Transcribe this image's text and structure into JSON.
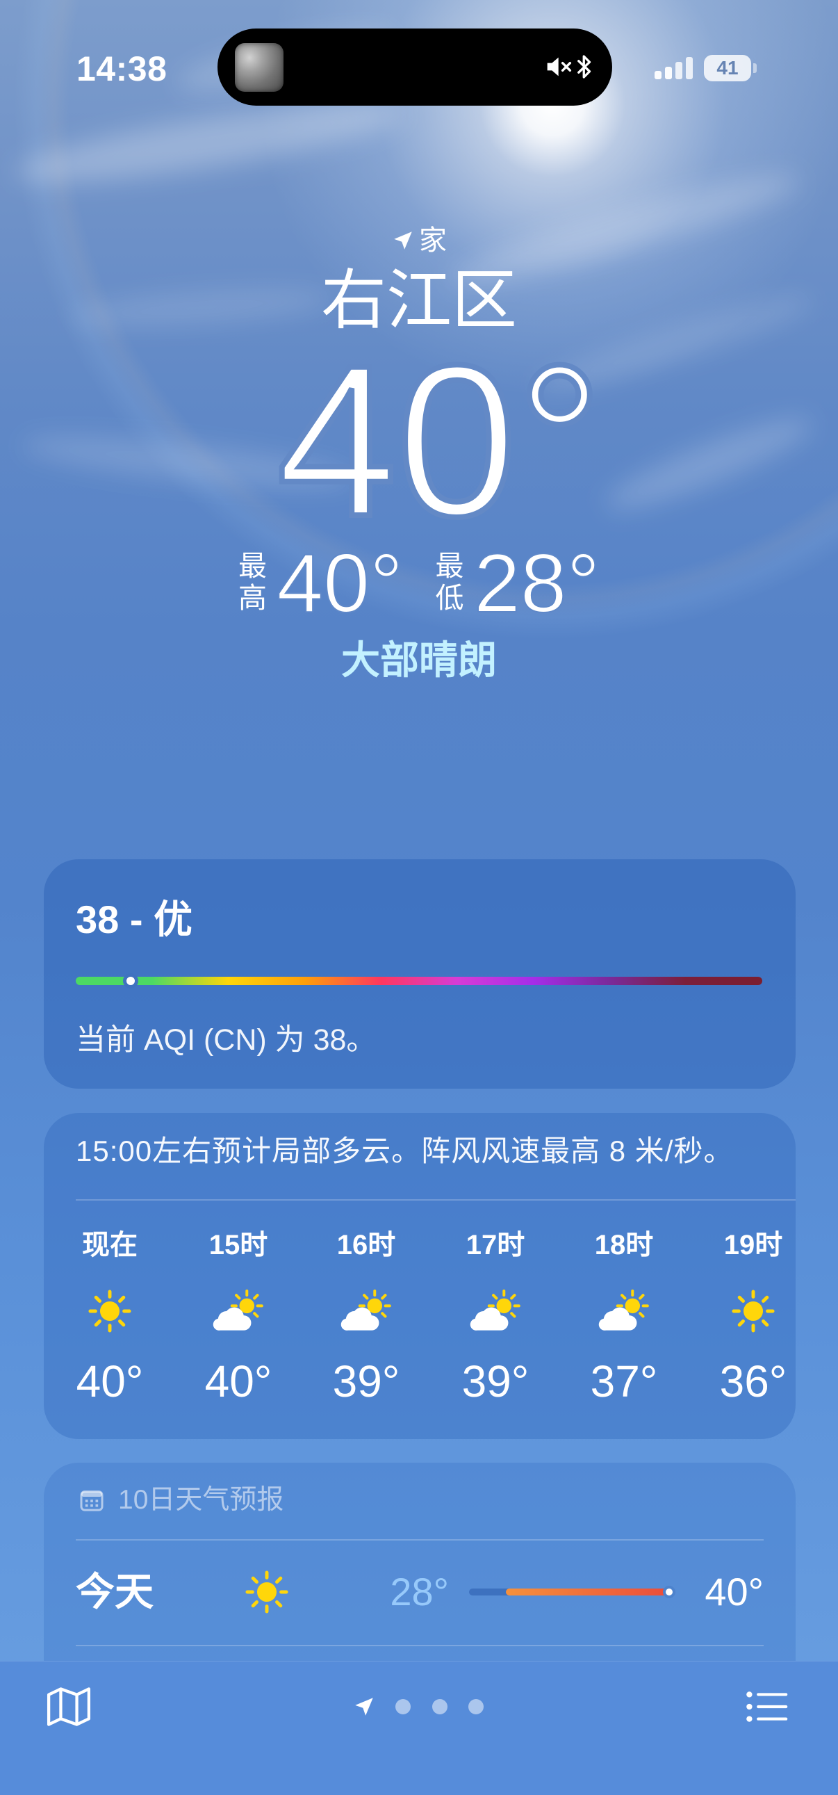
{
  "status_bar": {
    "time": "14:38",
    "battery_level": "41",
    "signal_icon": "cellular-signal-icon",
    "battery_icon": "battery-icon"
  },
  "dynamic_island": {
    "thumbnail": "now-playing-thumbnail",
    "audio_icon": "speaker-muted-icon",
    "bluetooth_icon": "bluetooth-icon"
  },
  "location": {
    "icon": "location-arrow-icon",
    "label": "家",
    "city": "右江区"
  },
  "current": {
    "temperature": "40°",
    "high_label": "最高",
    "high": "40°",
    "low_label": "最低",
    "low": "28°",
    "condition": "大部晴朗"
  },
  "aqi": {
    "title": "38 - 优",
    "description": "当前 AQI (CN) 为 38。",
    "indicator_fraction": 0.08
  },
  "hourly": {
    "summary": "15:00左右预计局部多云。阵风风速最高 8 米/秒。",
    "items": [
      {
        "label": "现在",
        "icon": "sun-icon",
        "temp": "40°"
      },
      {
        "label": "15时",
        "icon": "partly-cloudy-icon",
        "temp": "40°"
      },
      {
        "label": "16时",
        "icon": "partly-cloudy-icon",
        "temp": "39°"
      },
      {
        "label": "17时",
        "icon": "partly-cloudy-icon",
        "temp": "39°"
      },
      {
        "label": "18时",
        "icon": "partly-cloudy-icon",
        "temp": "37°"
      },
      {
        "label": "19时",
        "icon": "sun-icon",
        "temp": "36°"
      }
    ]
  },
  "daily": {
    "icon": "calendar-icon",
    "header": "10日天气预报",
    "rows": [
      {
        "day": "今天",
        "icon": "sun-icon",
        "low": "28°",
        "high": "40°",
        "range_start": 0.18,
        "range_end": 1.0,
        "current_fraction": 0.97
      }
    ]
  },
  "bottom_bar": {
    "left_icon": "map-icon",
    "current_page_icon": "location-arrow-icon",
    "page_dots": 3,
    "right_icon": "list-icon"
  },
  "colors": {
    "condition_text": "#c3f1ff",
    "sun": "#ffd60a",
    "low_temp_text": "#a0d2ff",
    "aqi_gradient": [
      "#4cd964",
      "#4cd964",
      "#ffd60a",
      "#ff9f0a",
      "#ff375f",
      "#d63cd6",
      "#a52ee8",
      "#7a2a9a",
      "#7b1f3a",
      "#7b1e2f"
    ],
    "temp_range_gradient": [
      "#f5913d",
      "#eb4a3b"
    ]
  }
}
